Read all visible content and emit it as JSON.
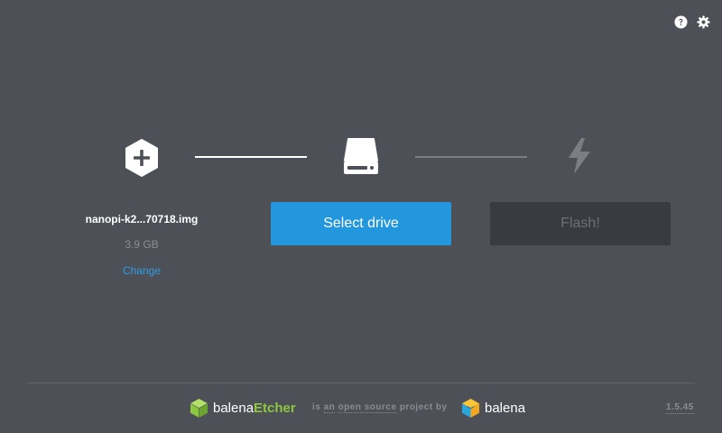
{
  "header": {
    "help_icon": "question-circle-icon",
    "settings_icon": "gear-icon"
  },
  "steps": {
    "image": {
      "icon": "plus-hexagon-icon",
      "name": "nanopi-k2...70718.img",
      "size": "3.9 GB",
      "change_label": "Change"
    },
    "drive": {
      "icon": "hard-drive-icon",
      "button_label": "Select drive"
    },
    "flash": {
      "icon": "lightning-bolt-icon",
      "button_label": "Flash!"
    }
  },
  "footer": {
    "etcher_brand_light": "balena",
    "etcher_brand_strong": "Etcher",
    "oss_prefix": "is",
    "oss_an": "an",
    "oss_open_source": "open source",
    "oss_project_by": "project by",
    "balena_brand": "balena",
    "version": "1.5.45"
  },
  "colors": {
    "background": "#4d5057",
    "accent": "#2297de",
    "etcher_green": "#8dc640",
    "disabled_button": "#393b40"
  }
}
